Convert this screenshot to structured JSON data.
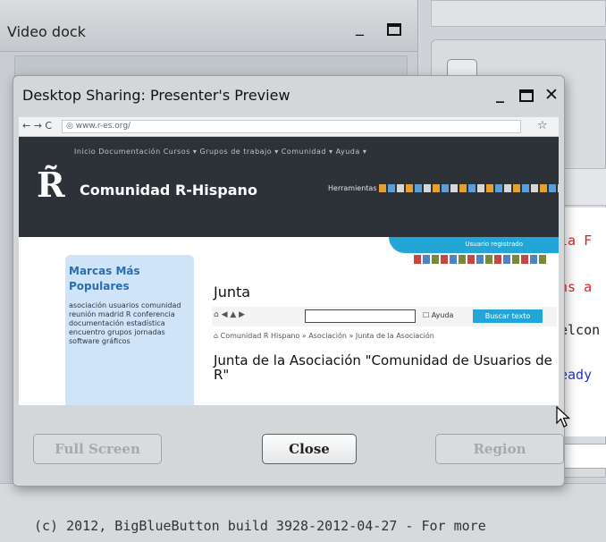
{
  "video_dock": {
    "title": "Video dock"
  },
  "chat": {
    "lines": [
      {
        "text": "la F",
        "color": "#e02020"
      },
      {
        "text": "ns a",
        "color": "#e02020"
      },
      {
        "text": "elcon",
        "color": "#222222"
      },
      {
        "text": "eady",
        "color": "#2a33c8"
      }
    ]
  },
  "footer": {
    "copyright": "(c) 2012, BigBlueButton build 3928-2012-04-27 - For more"
  },
  "preview": {
    "title": "Desktop Sharing: Presenter's Preview",
    "buttons": {
      "full_screen": "Full Screen",
      "close": "Close",
      "region": "Region"
    }
  },
  "shared": {
    "browser": {
      "nav": "← → C",
      "url": "◎ www.r-es.org/",
      "star": "☆"
    },
    "site": {
      "nav": "Inicio  Documentación  Cursos ▾  Grupos de trabajo ▾  Comunidad ▾  Ayuda ▾",
      "logo": "R̃",
      "name": "Comunidad R-Hispano",
      "tools_label": "Herramientas"
    },
    "user_banner": "Usuario registrado",
    "sidebar": {
      "title": "Marcas Más Populares",
      "text": "asociación  usuarios  comunidad  reunión  madrid  R  conferencia  documentación  estadística  encuentro  grupos  jornadas  software  gráficos"
    },
    "page_title": "Junta",
    "toolbar": {
      "nav": "⌂ ◀ ▲ ▶",
      "search_check": "☐ Ayuda",
      "search_button": "Buscar texto"
    },
    "breadcrumb": "⌂ Comunidad R Hispano » Asociación » Junta de la Asociación",
    "heading": "Junta de la Asociación \"Comunidad de Usuarios de R\""
  }
}
